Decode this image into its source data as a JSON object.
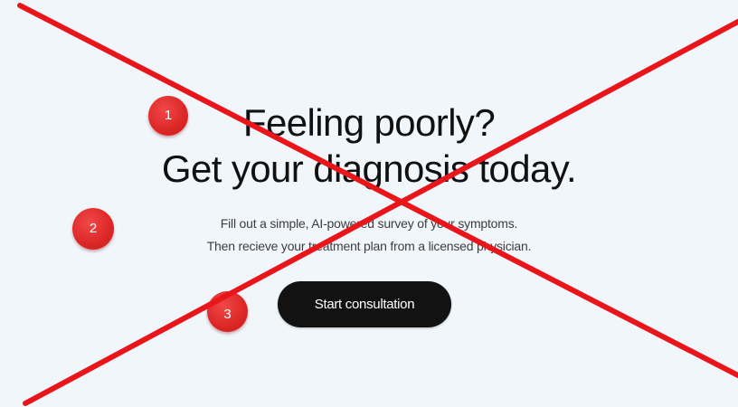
{
  "hero": {
    "headline_line1": "Feeling poorly?",
    "headline_line2": "Get your diagnosis today.",
    "subtitle_line1": "Fill out a simple, AI-powered survey of your symptoms.",
    "subtitle_line2": "Then recieve your treatment plan from a licensed physician.",
    "cta_label": "Start consultation"
  },
  "annotations": {
    "markers": [
      "1",
      "2",
      "3"
    ],
    "marker_color": "#dc2626",
    "cross_color": "#e8151b"
  },
  "colors": {
    "background": "#f1f6fb",
    "text": "#111111",
    "button_bg": "#121212",
    "button_text": "#ffffff"
  }
}
